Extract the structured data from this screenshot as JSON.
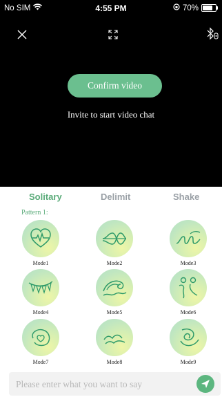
{
  "status_bar": {
    "carrier": "No SIM",
    "time": "4:55 PM",
    "battery_text": "70%",
    "battery_level": 0.7
  },
  "video": {
    "confirm_label": "Confirm video",
    "invite_text": "Invite to start video chat"
  },
  "tabs": [
    {
      "label": "Solitary",
      "active": true
    },
    {
      "label": "Delimit",
      "active": false
    },
    {
      "label": "Shake",
      "active": false
    }
  ],
  "pattern_label": "Pattern 1:",
  "modes": [
    {
      "label": "Mode1",
      "icon": "heart-pulse-icon"
    },
    {
      "label": "Mode2",
      "icon": "sine-wave-icon"
    },
    {
      "label": "Mode3",
      "icon": "loops-icon"
    },
    {
      "label": "Mode4",
      "icon": "bunting-icon"
    },
    {
      "label": "Mode5",
      "icon": "wave-icon"
    },
    {
      "label": "Mode6",
      "icon": "people-icon"
    },
    {
      "label": "Mode7",
      "icon": "heart-swirl-icon"
    },
    {
      "label": "Mode8",
      "icon": "hills-icon"
    },
    {
      "label": "Mode9",
      "icon": "spiral-icon"
    }
  ],
  "chat_input": {
    "placeholder": "Please enter what you want to say"
  },
  "colors": {
    "accent": "#5aab79",
    "confirm_button": "#6bbf8f",
    "inactive_tab": "#9aa0a6"
  }
}
